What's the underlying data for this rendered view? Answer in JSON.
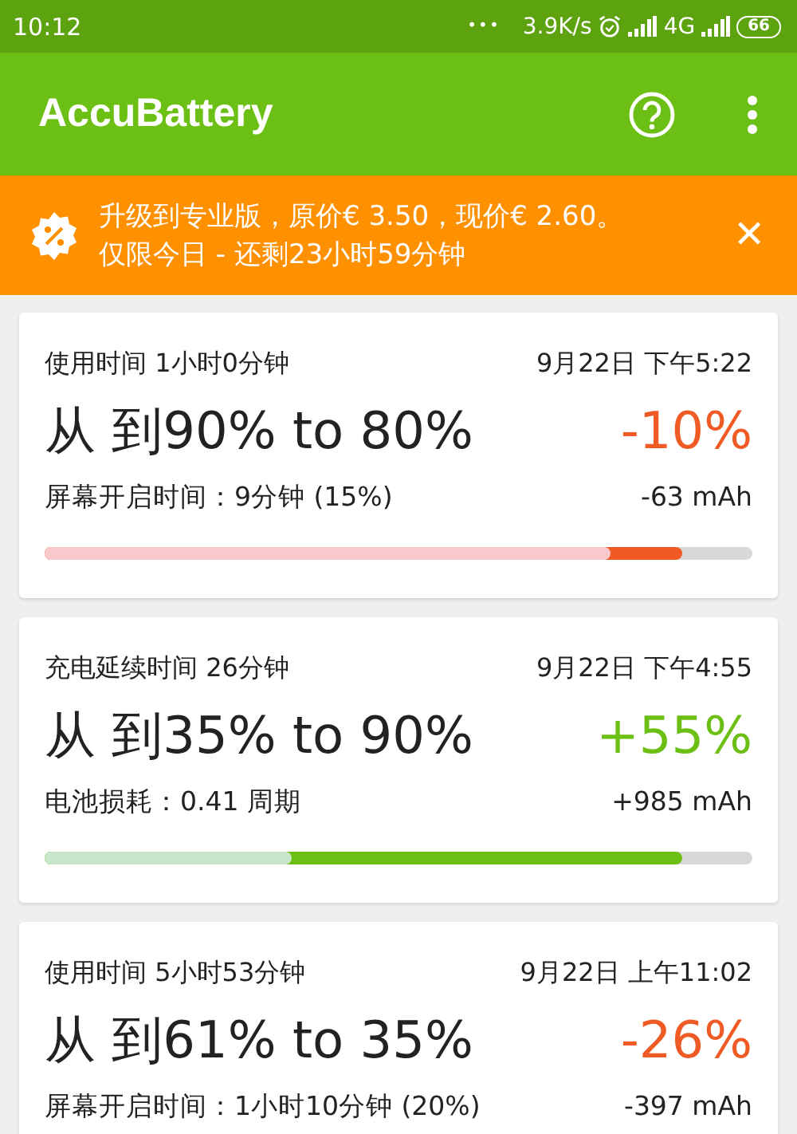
{
  "status_bar": {
    "time": "10:12",
    "dots": "•••",
    "speed": "3.9K/s",
    "network": "4G",
    "battery": "66"
  },
  "app_bar": {
    "title": "AccuBattery"
  },
  "banner": {
    "line_1": "升级到专业版，原价€ 3.50，现价€ 2.60。",
    "line_2": "仅限今日 - 还剩23小时59分钟",
    "close": "✕"
  },
  "sessions": [
    {
      "kind": "discharge",
      "duration": "使用时间 1小时0分钟",
      "date": "9月22日 下午5:22",
      "range": "从 到90% to 80%",
      "change": "-10%",
      "detail": "屏幕开启时间：9分钟 (15%)",
      "mah": "-63 mAh",
      "bar": {
        "low": {
          "level": 0.8
        },
        "high": {
          "level": 0.9
        }
      }
    },
    {
      "kind": "charge",
      "duration": "充电延续时间 26分钟",
      "date": "9月22日 下午4:55",
      "range": "从 到35% to 90%",
      "change": "+55%",
      "detail": "电池损耗：0.41 周期",
      "mah": "+985 mAh",
      "bar": {
        "low": {
          "level": 0.35
        },
        "high": {
          "level": 0.9
        }
      }
    },
    {
      "kind": "discharge",
      "duration": "使用时间 5小时53分钟",
      "date": "9月22日 上午11:02",
      "range": "从 到61% to 35%",
      "change": "-26%",
      "detail": "屏幕开启时间：1小时10分钟 (20%)",
      "mah": "-397 mAh"
    }
  ]
}
